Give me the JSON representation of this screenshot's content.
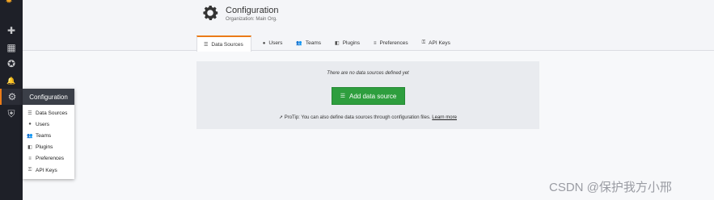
{
  "sidebar": {
    "items": [
      {
        "icon": "plus-icon",
        "glyph": "✚"
      },
      {
        "icon": "dashboards-icon",
        "glyph": "▦"
      },
      {
        "icon": "explore-icon",
        "glyph": "✪"
      },
      {
        "icon": "alerting-bell-icon",
        "glyph": "🔔"
      },
      {
        "icon": "configuration-gear-icon",
        "glyph": "⚙"
      },
      {
        "icon": "server-admin-shield-icon",
        "glyph": "⛨"
      }
    ]
  },
  "flyout": {
    "title": "Configuration",
    "items": [
      {
        "label": "Data Sources",
        "icon": "database-icon",
        "glyph": "☰"
      },
      {
        "label": "Users",
        "icon": "user-icon",
        "glyph": "●"
      },
      {
        "label": "Teams",
        "icon": "teams-icon",
        "glyph": "👥"
      },
      {
        "label": "Plugins",
        "icon": "plugin-icon",
        "glyph": "◧"
      },
      {
        "label": "Preferences",
        "icon": "sliders-icon",
        "glyph": "≡"
      },
      {
        "label": "API Keys",
        "icon": "key-icon",
        "glyph": "⚿"
      }
    ]
  },
  "header": {
    "title": "Configuration",
    "subtitle": "Organization: Main Org."
  },
  "tabs": [
    {
      "label": "Data Sources",
      "glyph": "☰",
      "active": true
    },
    {
      "label": "Users",
      "glyph": "●"
    },
    {
      "label": "Teams",
      "glyph": "👥"
    },
    {
      "label": "Plugins",
      "glyph": "◧"
    },
    {
      "label": "Preferences",
      "glyph": "≡"
    },
    {
      "label": "API Keys",
      "glyph": "⚿"
    }
  ],
  "empty_state": {
    "message": "There are no data sources defined yet",
    "button_label": "Add data source",
    "protip_text": "ProTip: You can also define data sources through configuration files.",
    "protip_link": "Learn more"
  },
  "watermark": "CSDN @保护我方小邢",
  "colors": {
    "accent": "#eb7b18",
    "button_green": "#2e9e3e",
    "sidebar_bg": "#1e2028"
  }
}
